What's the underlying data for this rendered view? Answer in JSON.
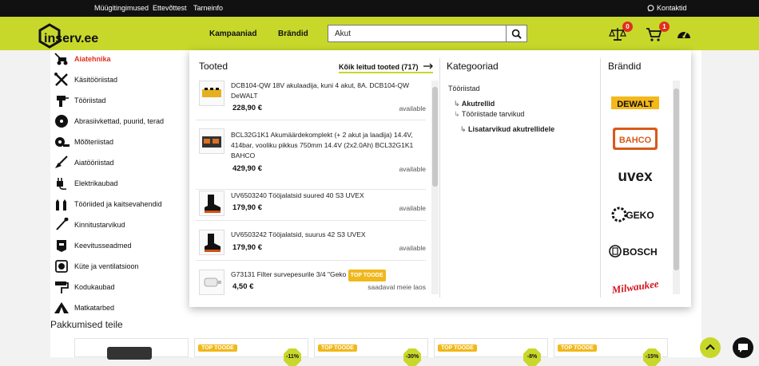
{
  "topbar": {
    "links": [
      "Müügitingimused",
      "Ettevõttest",
      "Tarneinfo"
    ],
    "contact": "Kontaktid"
  },
  "header": {
    "logo": "inserv.ee",
    "nav": [
      "Kampaaniad",
      "Brändid"
    ],
    "search_value": "Akut",
    "compare_badge": "0",
    "cart_badge": "1",
    "colors": {
      "brand": "#c8d82b",
      "topbar": "#111111",
      "accent": "#e0301e",
      "tag": "#f0b81a"
    }
  },
  "sidebar": {
    "items": [
      "Aiatehnika",
      "Käsitööriistad",
      "Tööriistad",
      "Abrasiivkettad, puurid, terad",
      "Mõõteriistad",
      "Aiatööriistad",
      "Elektrikaubad",
      "Tööriided ja kaitsevahendid",
      "Kinnitustarvikud",
      "Keevitusseadmed",
      "Küte ja ventilatsioon",
      "Kodukaubad",
      "Matkatarbed"
    ]
  },
  "dropdown": {
    "products_title": "Tooted",
    "all_results": "Kõik leitud tooted (717)",
    "products": [
      {
        "name": "DCB104-QW 18V akulaadija, kuni 4 akut, 8A. DCB104-QW DeWALT",
        "price": "228,90 €",
        "avail": "available"
      },
      {
        "name": "BCL32G1K1 Akumäärdekomplekt (+ 2 akut ja laadija) 14.4V, 414bar, vooliku pikkus 750mm 14.4V (2x2.0Ah) BCL32G1K1 BAHCO",
        "price": "429,90 €",
        "avail": "available"
      },
      {
        "name": "UV6503240 Tööjalatsid suured 40 S3 UVEX",
        "price": "179,90 €",
        "avail": "available"
      },
      {
        "name": "UV6503242 Tööjalatsid, suurus 42 S3 UVEX",
        "price": "179,90 €",
        "avail": "available"
      },
      {
        "name": "G73131 Filter survepesurile 3/4 \"Geko",
        "tag": "TOP TOODE",
        "price": "4,50 €",
        "avail": "saadaval meie laos"
      }
    ],
    "categories_title": "Kategooriad",
    "categories": [
      "Tööriistad",
      "Akutrellid",
      "Tööriistade tarvikud",
      "Lisatarvikud akutrellidele"
    ],
    "brands_title": "Brändid",
    "brands": [
      "DEWALT",
      "BAHCO",
      "uvex",
      "GEKO",
      "BOSCH",
      "Milwaukee"
    ]
  },
  "offers": {
    "title": "Pakkumised teile",
    "cards": [
      {
        "tag": "TOP TOODE",
        "disc": "-11%"
      },
      {
        "tag": "TOP TOODE",
        "disc": "-30%"
      },
      {
        "tag": "TOP TOODE",
        "disc": "-8%"
      },
      {
        "tag": "TOP TOODE",
        "disc": "-15%"
      }
    ]
  }
}
